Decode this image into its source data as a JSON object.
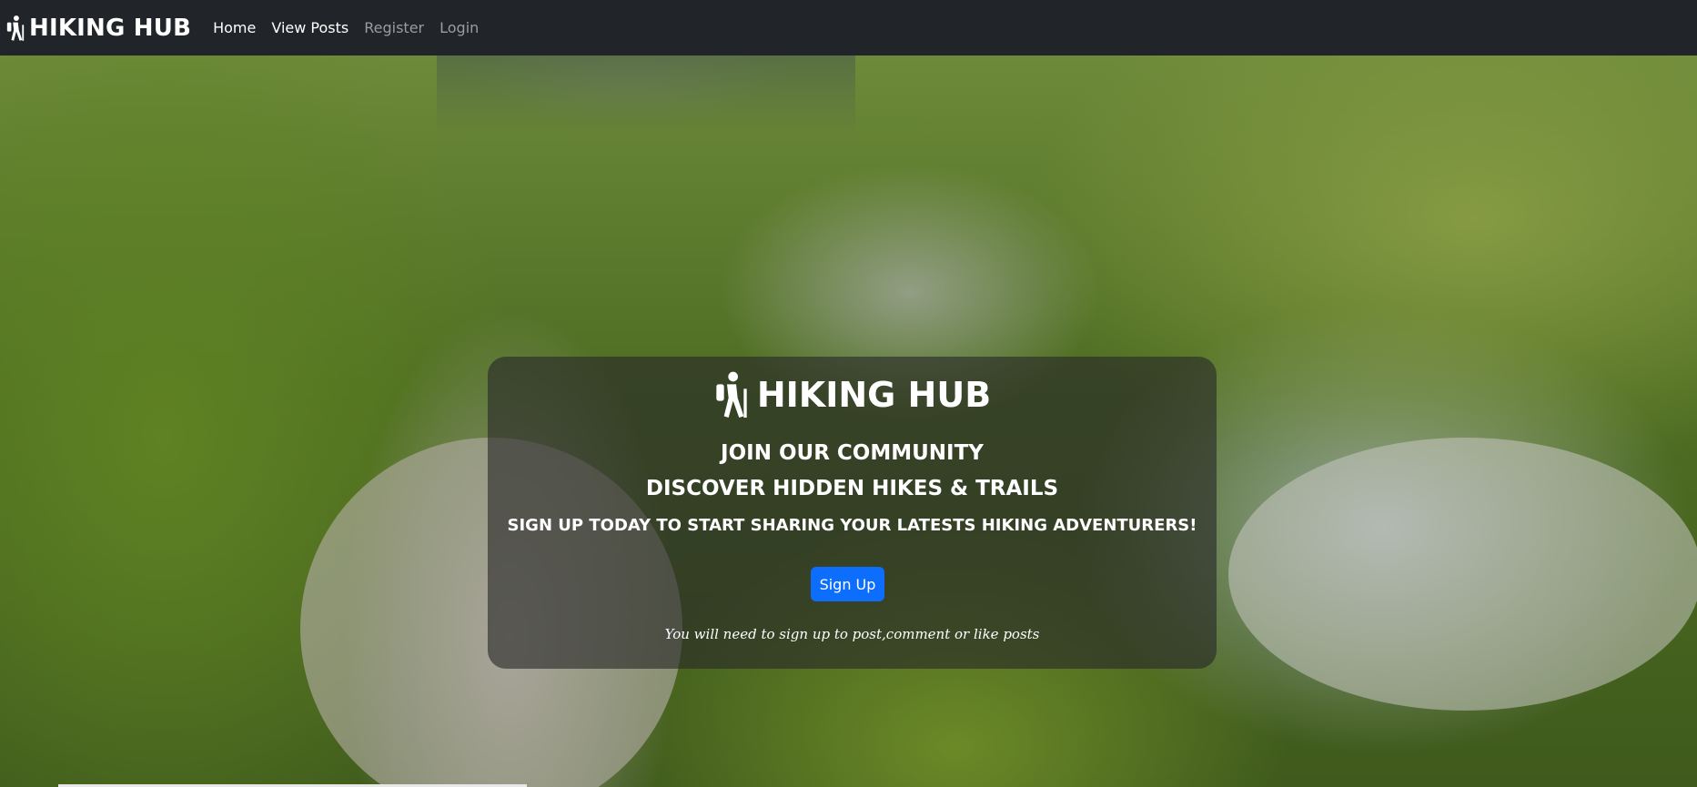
{
  "navbar": {
    "brand": "HIKING HUB",
    "brand_icon": "hiker-icon",
    "links": [
      {
        "label": "Home",
        "state": "active"
      },
      {
        "label": "View Posts",
        "state": "active"
      },
      {
        "label": "Register",
        "state": "muted"
      },
      {
        "label": "Login",
        "state": "muted"
      }
    ]
  },
  "hero": {
    "background": "mountain-valley-trail-photo",
    "card": {
      "brand": "HIKING HUB",
      "brand_icon": "hiker-icon",
      "heading_1": "JOIN OUR COMMUNITY",
      "heading_2": "DISCOVER HIDDEN HIKES & TRAILS",
      "heading_3": "SIGN UP TODAY TO START SHARING YOUR LATESTS HIKING ADVENTURERS!",
      "button_label": "Sign Up",
      "note": "You will need to sign up to post,comment or like posts"
    }
  },
  "colors": {
    "navbar_bg": "#212529",
    "primary_button": "#0d6efd",
    "card_overlay": "rgba(40,40,40,0.62)"
  }
}
